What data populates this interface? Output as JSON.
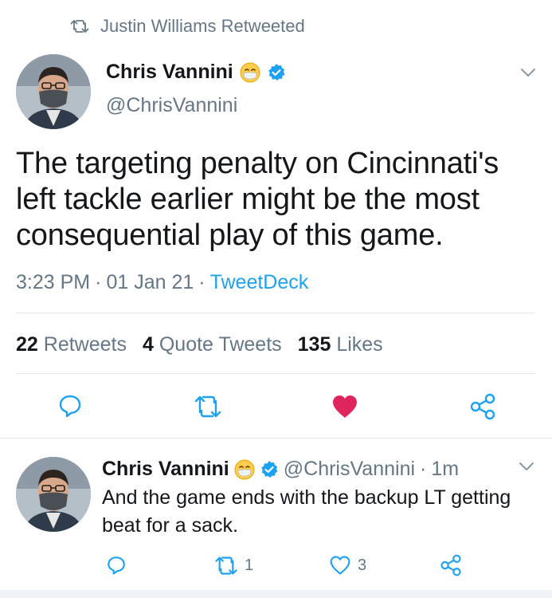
{
  "retweet_header": {
    "text": "Justin Williams Retweeted"
  },
  "tweet": {
    "display_name": "Chris Vannini",
    "handle": "@ChrisVannini",
    "text": "The targeting penalty on Cincinnati's left tackle earlier might be the most consequential play of this game.",
    "time": "3:23 PM",
    "date": "01 Jan 21",
    "separator": "·",
    "client": "TweetDeck",
    "stats": {
      "retweets_count": "22",
      "retweets_label": "Retweets",
      "quotes_count": "4",
      "quotes_label": "Quote Tweets",
      "likes_count": "135",
      "likes_label": "Likes"
    },
    "liked": true
  },
  "reply": {
    "display_name": "Chris Vannini",
    "handle": "@ChrisVannini",
    "separator": "·",
    "time_ago": "1m",
    "text": "And the game ends with the backup LT getting beat for a sack.",
    "retweet_count": "1",
    "like_count": "3"
  },
  "colors": {
    "accent": "#1da1f2",
    "like_red": "#e0245e",
    "secondary_text": "#657786"
  }
}
